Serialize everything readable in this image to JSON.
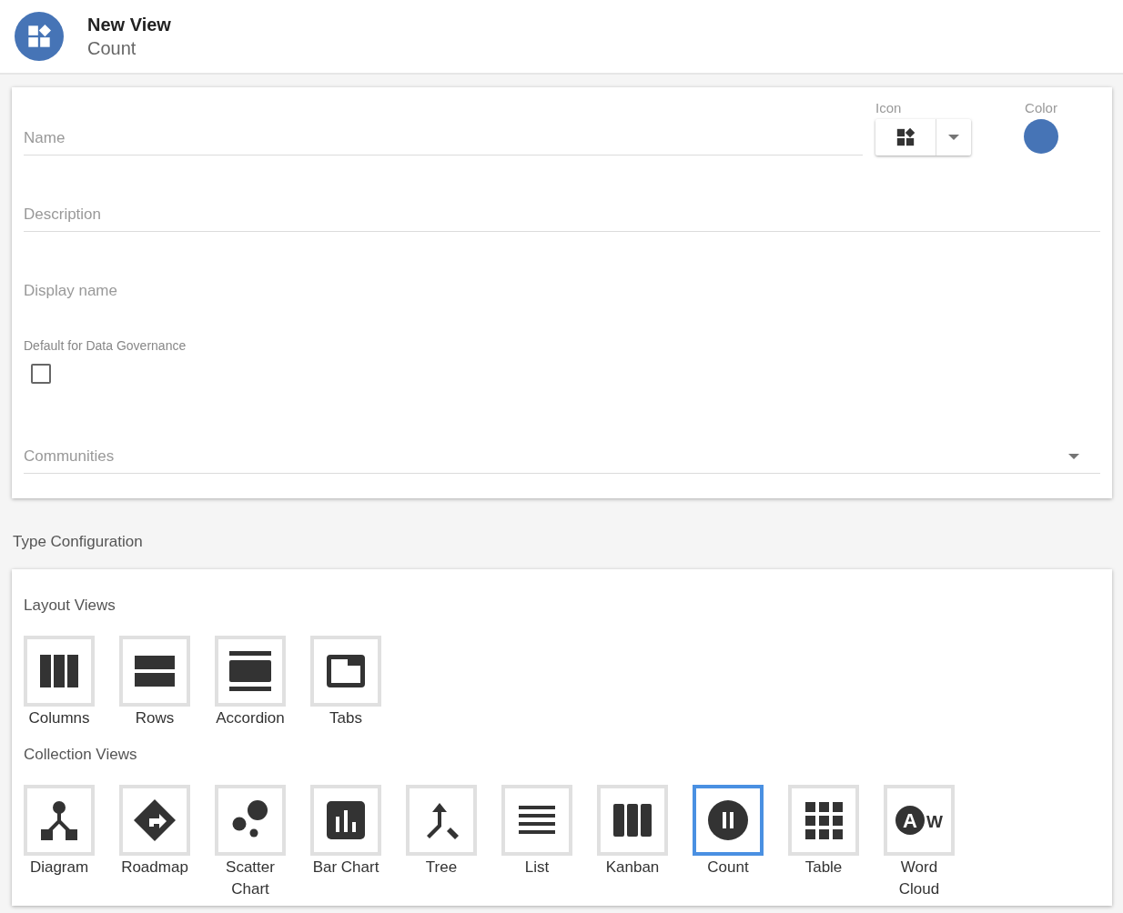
{
  "header": {
    "title": "New View",
    "subtitle": "Count"
  },
  "form": {
    "fields": [
      {
        "kind": "underlined",
        "placeholder": "Name"
      },
      {
        "kind": "underlined",
        "placeholder": "Description"
      },
      {
        "kind": "bare",
        "placeholder": "Display name"
      },
      {
        "kind": "checkbox",
        "label": "Default for Data Governance",
        "checked": false
      },
      {
        "kind": "select",
        "placeholder": "Communities"
      }
    ],
    "icon_picker": {
      "label": "Icon"
    },
    "color": {
      "label": "Color"
    }
  },
  "type_configuration": {
    "title": "Type Configuration",
    "sections": [
      {
        "title": "Layout Views",
        "items": [
          {
            "kind": "columns",
            "label": "Columns",
            "selected": false
          },
          {
            "kind": "rows",
            "label": "Rows",
            "selected": false
          },
          {
            "kind": "accordion",
            "label": "Accordion",
            "selected": false
          },
          {
            "kind": "tabs",
            "label": "Tabs",
            "selected": false
          }
        ]
      },
      {
        "title": "Collection Views",
        "items": [
          {
            "kind": "diagram",
            "label": "Diagram",
            "selected": false
          },
          {
            "kind": "roadmap",
            "label": "Roadmap",
            "selected": false
          },
          {
            "kind": "scatter",
            "label": "Scatter Chart",
            "selected": false
          },
          {
            "kind": "bar",
            "label": "Bar Chart",
            "selected": false
          },
          {
            "kind": "tree",
            "label": "Tree",
            "selected": false
          },
          {
            "kind": "list",
            "label": "List",
            "selected": false
          },
          {
            "kind": "kanban",
            "label": "Kanban",
            "selected": false
          },
          {
            "kind": "count",
            "label": "Count",
            "selected": true
          },
          {
            "kind": "table",
            "label": "Table",
            "selected": false
          },
          {
            "kind": "wordcloud",
            "label": "Word Cloud",
            "selected": false,
            "icon_letters": [
              "A",
              "W"
            ]
          }
        ]
      }
    ]
  }
}
